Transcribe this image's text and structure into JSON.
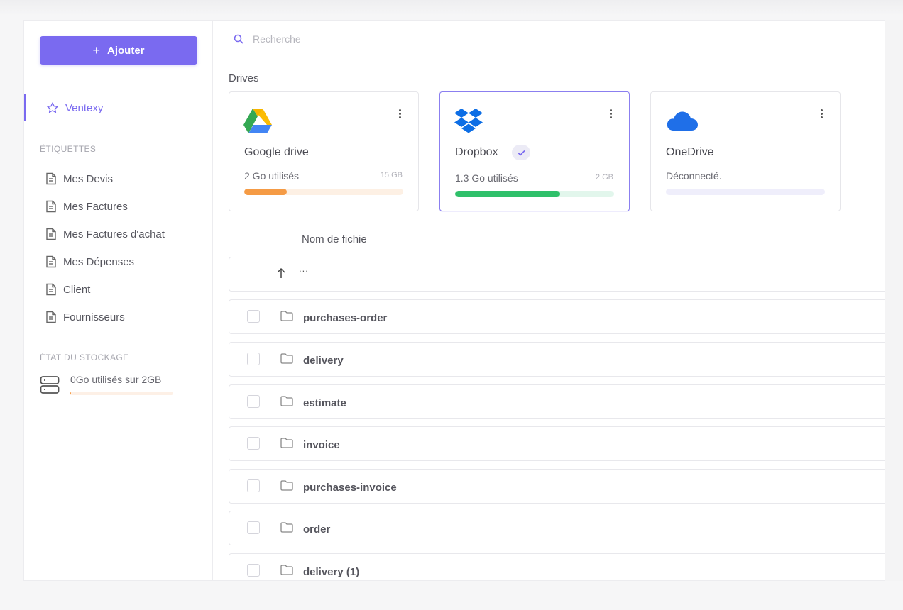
{
  "sidebar": {
    "add_label": "Ajouter",
    "active_item": "Ventexy",
    "labels_title": "ÉTIQUETTES",
    "items": [
      {
        "label": "Mes Devis"
      },
      {
        "label": "Mes Factures"
      },
      {
        "label": "Mes Factures d'achat"
      },
      {
        "label": "Mes Dépenses"
      },
      {
        "label": "Client"
      },
      {
        "label": "Fournisseurs"
      }
    ],
    "storage_title": "ÉTAT DU STOCKAGE",
    "storage_text": "0Go utilisés sur 2GB",
    "storage_fraction": 0.01
  },
  "search": {
    "placeholder": "Recherche"
  },
  "drives_label": "Drives",
  "drives": [
    {
      "name": "Google drive",
      "usage": "2 Go utilisés",
      "capacity": "15 GB",
      "fraction": 0.27,
      "color": "#f59b45",
      "track": "#fdf0e4",
      "icon": "google-drive-icon"
    },
    {
      "name": "Dropbox",
      "usage": "1.3 Go utilisés",
      "capacity": "2 GB",
      "fraction": 0.66,
      "color": "#2fc06a",
      "track": "#e2f6ec",
      "icon": "dropbox-icon",
      "selected": true
    },
    {
      "name": "OneDrive",
      "usage": "Déconnecté.",
      "capacity": "",
      "fraction": 0,
      "color": "#8b7ff0",
      "track": "#efeefb",
      "icon": "onedrive-icon"
    }
  ],
  "file_list": {
    "column_header": "Nom de fichie",
    "parent_label": "...",
    "items": [
      {
        "name": "purchases-order"
      },
      {
        "name": "delivery"
      },
      {
        "name": "estimate"
      },
      {
        "name": "invoice"
      },
      {
        "name": "purchases-invoice"
      },
      {
        "name": "order"
      },
      {
        "name": "delivery (1)"
      }
    ]
  }
}
